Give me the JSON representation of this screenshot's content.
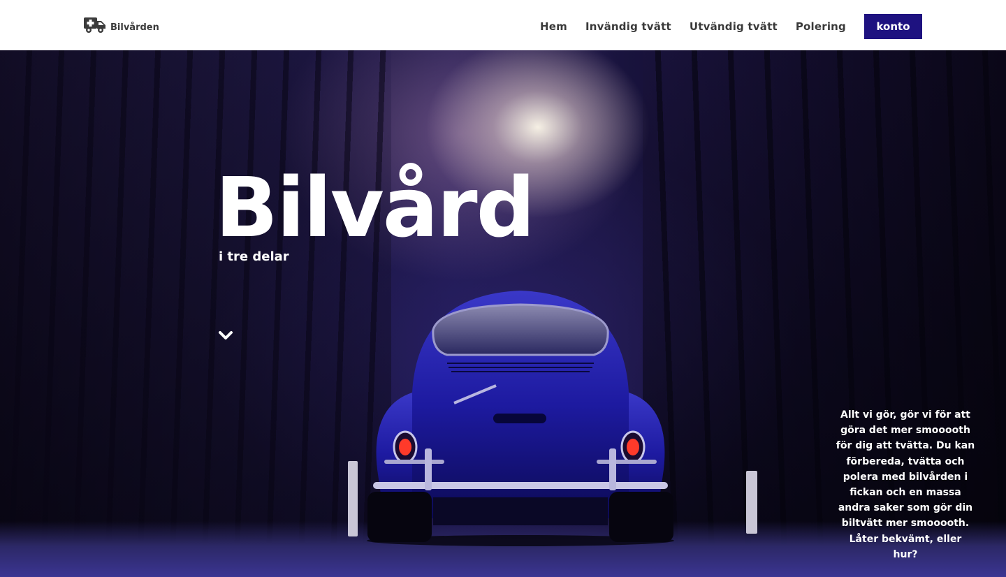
{
  "header": {
    "logo": {
      "icon": "ambulance-icon",
      "text": "Bilvården"
    },
    "nav": [
      {
        "label": "Hem"
      },
      {
        "label": "Invändig tvätt"
      },
      {
        "label": "Utvändig tvätt"
      },
      {
        "label": "Polering"
      }
    ],
    "account_button": "konto"
  },
  "hero": {
    "title": "Bilvård",
    "subtitle": "i tre delar",
    "scroll_icon": "chevron-down-icon",
    "description": "Allt vi gör, gör vi för att göra det mer smooooth för dig att tvätta. Du kan förbereda, tvätta och polera med bilvården i fickan och en massa andra saker som gör din biltvätt mer smooooth. Låter bekvämt, eller hur?"
  },
  "colors": {
    "accent": "#1e1280",
    "nav_text": "#3a3a3a",
    "header_bg": "#ffffff",
    "hero_text": "#ffffff"
  }
}
